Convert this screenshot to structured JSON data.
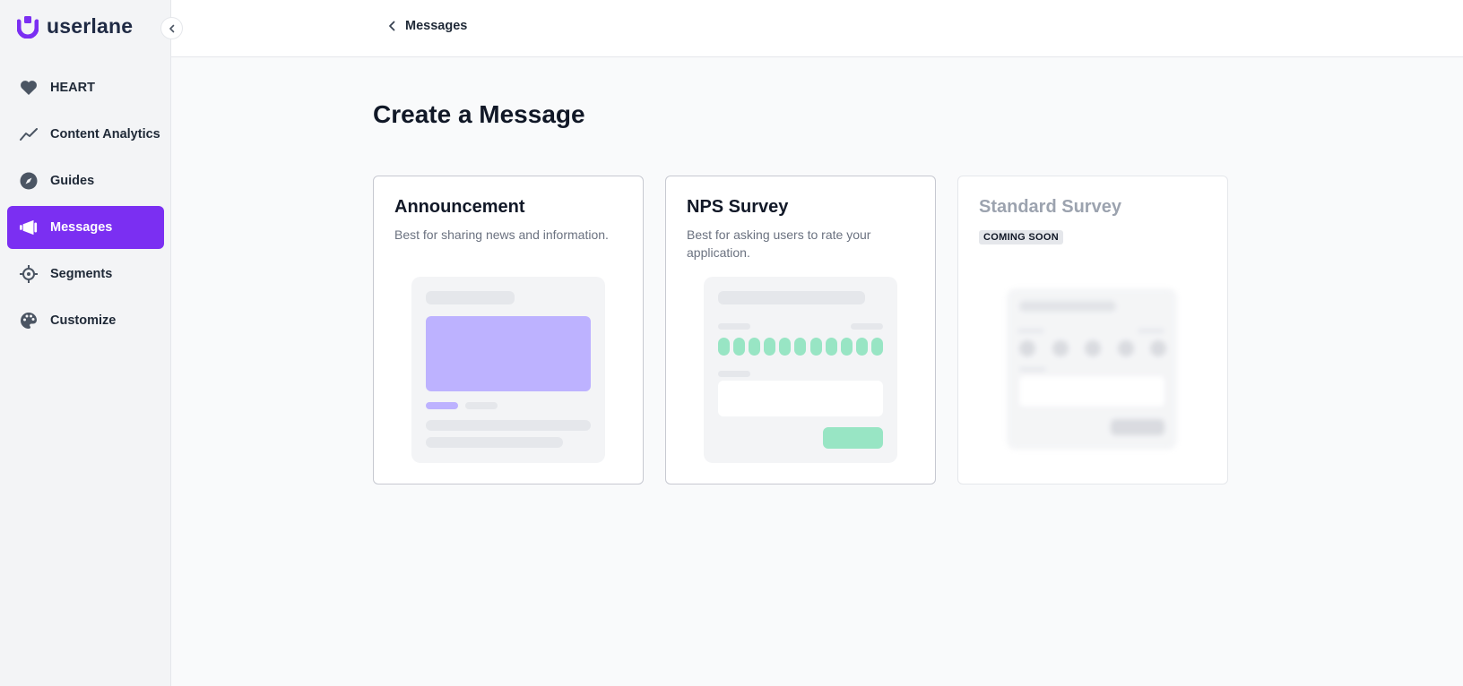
{
  "app": {
    "logo_text": "userlane",
    "brand_color": "#7b2ff2"
  },
  "sidebar": {
    "items": [
      {
        "label": "HEART",
        "icon": "heart-icon",
        "active": false
      },
      {
        "label": "Content Analytics",
        "icon": "trend-line-icon",
        "active": false
      },
      {
        "label": "Guides",
        "icon": "compass-icon",
        "active": false
      },
      {
        "label": "Messages",
        "icon": "megaphone-icon",
        "active": true
      },
      {
        "label": "Segments",
        "icon": "crosshair-icon",
        "active": false
      },
      {
        "label": "Customize",
        "icon": "palette-icon",
        "active": false
      }
    ]
  },
  "topbar": {
    "breadcrumb_label": "Messages"
  },
  "main": {
    "title": "Create a Message",
    "cards": [
      {
        "title": "Announcement",
        "description": "Best for sharing news and information.",
        "illustration": "announcement-preview",
        "accent": "#bdb2ff"
      },
      {
        "title": "NPS Survey",
        "description": "Best for asking users to rate your application.",
        "illustration": "nps-preview",
        "accent": "#98e5c4"
      },
      {
        "title": "Standard Survey",
        "badge": "COMING SOON",
        "illustration": "standard-survey-preview",
        "disabled": true
      }
    ]
  }
}
